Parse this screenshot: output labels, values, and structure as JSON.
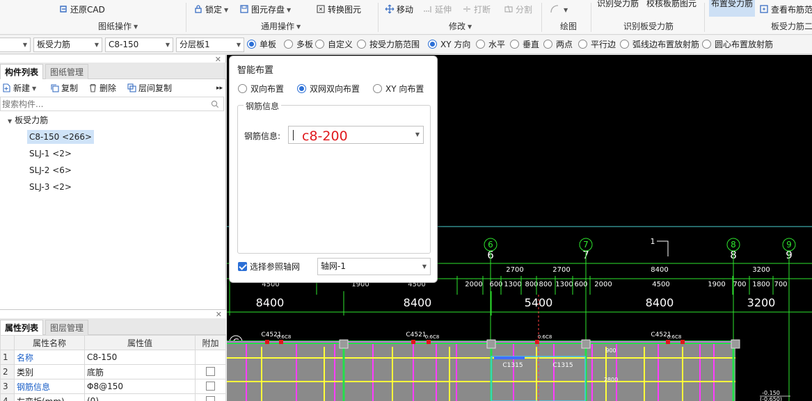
{
  "ribbon": {
    "restore_cad": "还原CAD",
    "group_drawing_ops": "图纸操作",
    "lock": "锁定",
    "save_element": "图元存盘",
    "convert_element": "转换图元",
    "group_common_ops": "通用操作",
    "move": "移动",
    "extend": "延伸",
    "break": "打断",
    "split": "分割",
    "group_modify": "修改",
    "group_draw": "绘图",
    "identify_rebar": "识别受力筋",
    "check_rebar_drawing": "校核板筋图元",
    "group_identify_slab_rebar": "识别板受力筋",
    "place_rebar": "布置受力筋",
    "view_layout": "查看布筋范",
    "group_slab_rebar": "板受力筋二"
  },
  "options": {
    "combo_type": "板受力筋",
    "combo_spec": "C8-150",
    "combo_layer": "分层板1",
    "radios": [
      {
        "label": "单板",
        "on": true
      },
      {
        "label": "多板",
        "on": false
      },
      {
        "label": "自定义",
        "on": false
      },
      {
        "label": "按受力筋范围",
        "on": false
      },
      {
        "label": "XY 方向",
        "on": true
      },
      {
        "label": "水平",
        "on": false
      },
      {
        "label": "垂直",
        "on": false
      },
      {
        "label": "两点",
        "on": false
      },
      {
        "label": "平行边",
        "on": false
      },
      {
        "label": "弧线边布置放射筋",
        "on": false
      },
      {
        "label": "圆心布置放射筋",
        "on": false
      }
    ]
  },
  "left": {
    "tab_components": "构件列表",
    "tab_drawings": "图纸管理",
    "new": "新建",
    "copy": "复制",
    "delete": "删除",
    "floor_copy": "层间复制",
    "search_placeholder": "搜索构件...",
    "tree_root": "板受力筋",
    "tree_items": [
      "C8-150 <266>",
      "SLJ-1 <2>",
      "SLJ-2 <6>",
      "SLJ-3 <2>"
    ]
  },
  "props": {
    "tab_props": "属性列表",
    "tab_layers": "图层管理",
    "col_name": "属性名称",
    "col_value": "属性值",
    "col_extra": "附加",
    "rows": [
      {
        "no": "1",
        "name": "名称",
        "value": "C8-150",
        "blue": true,
        "check": false
      },
      {
        "no": "2",
        "name": "类别",
        "value": "底筋",
        "blue": false,
        "check": true
      },
      {
        "no": "3",
        "name": "钢筋信息",
        "value": "♠",
        "blue": true,
        "check": true
      },
      {
        "no": "4",
        "name": "左弯折(mm)",
        "value": "(0)",
        "blue": false,
        "check": true
      }
    ],
    "rebar_value": "Φ8@150"
  },
  "dialog": {
    "title": "智能布置",
    "radio_bidir": "双向布置",
    "radio_double_net": "双网双向布置",
    "radio_xy": "XY 向布置",
    "group_rebar_info": "钢筋信息",
    "label_rebar_info": "钢筋信息:",
    "typed_value": "c8-200",
    "check_grid": "选择参照轴网",
    "grid_value": "轴网-1"
  },
  "drawing": {
    "axis_labels": [
      "6",
      "7",
      "8",
      "9"
    ],
    "axis_top_dims": [
      "2700",
      "2700",
      "8400",
      "3200"
    ],
    "fine_dims": [
      "4500",
      "1900",
      "4500",
      "2000",
      "600",
      "1300",
      "800",
      "800",
      "1300",
      "600",
      "2000",
      "4500",
      "1900",
      "700",
      "1800",
      "700"
    ],
    "bay_dims": [
      "8400",
      "8400",
      "5400",
      "8400",
      "3200"
    ],
    "row_label": "C",
    "marker_1": "1",
    "beam_labels": [
      "C4521",
      "C4521",
      "C4521"
    ],
    "beam_tags": [
      "0:6C8",
      "0:6C8",
      "0:6C8",
      "0:6C8"
    ],
    "col_labels": [
      "C1315",
      "C1315"
    ],
    "elev_1": "-0.150",
    "elev_2": "(-0.650)",
    "small_marks": [
      "900",
      "2800"
    ]
  }
}
